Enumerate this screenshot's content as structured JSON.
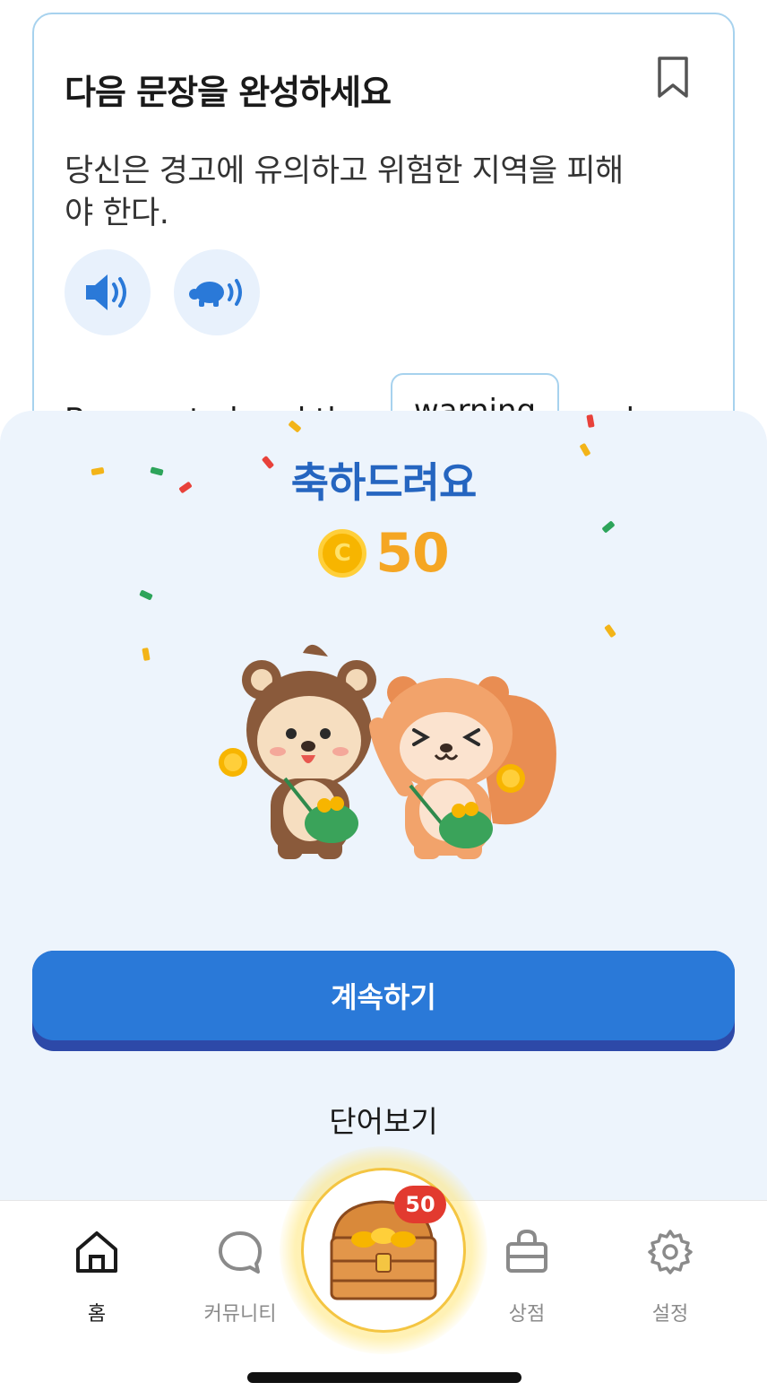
{
  "card": {
    "title": "다음 문장을 완성하세요",
    "prompt": "당신은 경고에 유의하고 위험한 지역을 피해야 한다.",
    "sentence_before": "Be sure to heed the",
    "answer": "warning",
    "sentence_after": "and"
  },
  "sheet": {
    "title": "축하드려요",
    "reward_amount": "50",
    "continue_label": "계속하기",
    "word_view_label": "단어보기"
  },
  "tabs": {
    "home": "홈",
    "community": "커뮤니티",
    "shop": "상점",
    "settings": "설정",
    "chest_badge": "50"
  },
  "colors": {
    "accent": "#2a79d8",
    "title": "#2565c0",
    "coin": "#f5a623",
    "badge": "#e23a2f"
  },
  "icons": [
    "bookmark-icon",
    "speaker-icon",
    "turtle-speaker-icon",
    "coin-icon",
    "home-icon",
    "chat-icon",
    "treasure-chest-icon",
    "bag-icon",
    "gear-icon"
  ]
}
